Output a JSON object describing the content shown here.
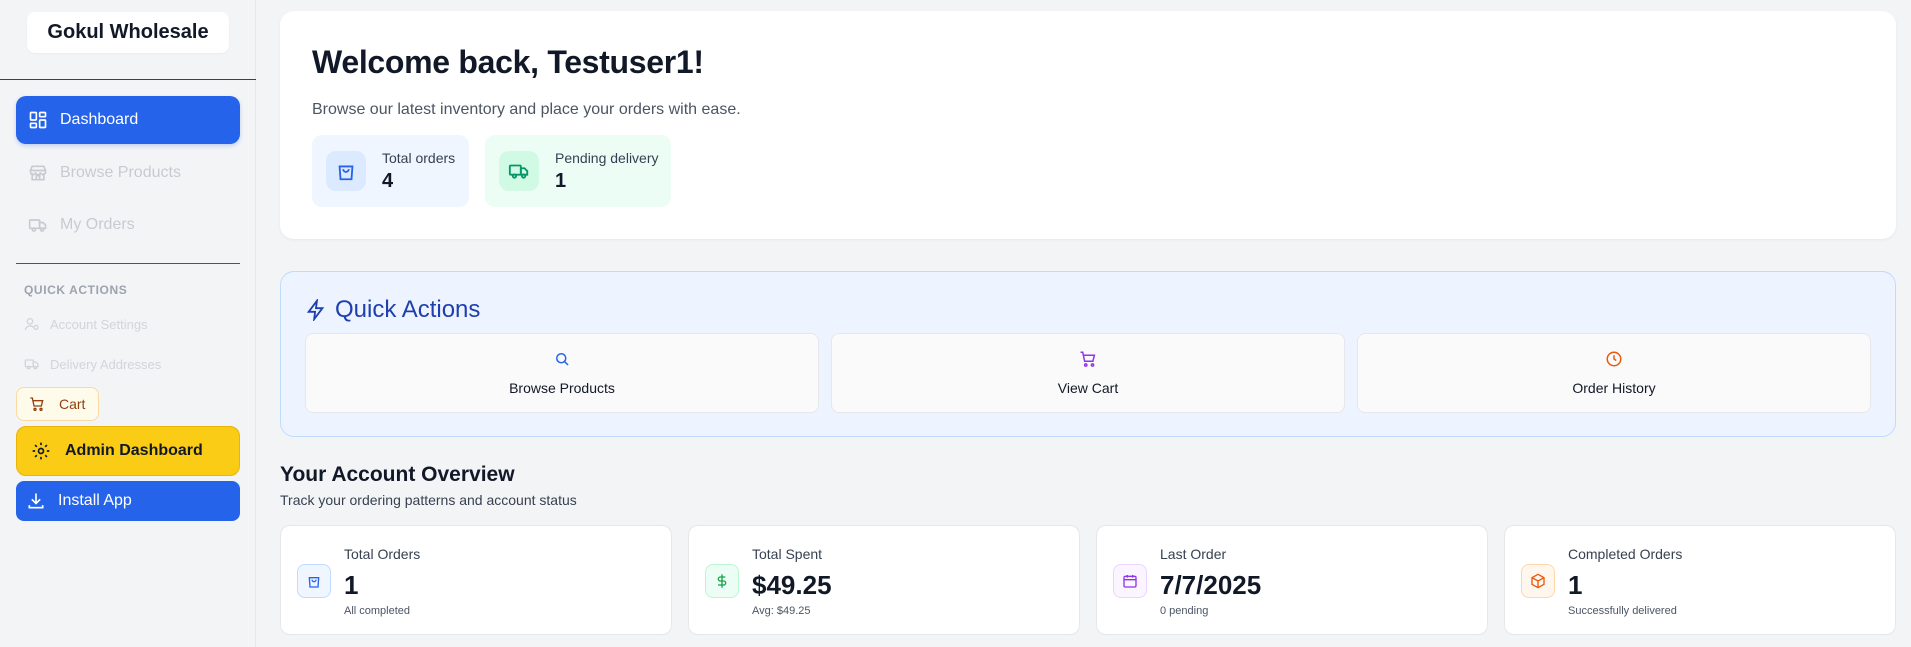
{
  "sidebar": {
    "brand": "Gokul Wholesale",
    "nav": [
      {
        "label": "Dashboard",
        "icon": "dashboard-icon",
        "active": true
      },
      {
        "label": "Browse Products",
        "icon": "store-icon",
        "active": false
      },
      {
        "label": "My Orders",
        "icon": "truck-icon",
        "active": false
      }
    ],
    "quick_actions_heading": "QUICK ACTIONS",
    "quick_links": [
      {
        "label": "Account Settings",
        "icon": "user-settings-icon"
      },
      {
        "label": "Delivery Addresses",
        "icon": "truck-icon"
      }
    ],
    "cart_label": "Cart",
    "admin_label": "Admin Dashboard",
    "install_label": "Install App"
  },
  "welcome": {
    "title": "Welcome back, Testuser1!",
    "subtitle": "Browse our latest inventory and place your orders with ease.",
    "stats": [
      {
        "label": "Total orders",
        "value": "4",
        "icon": "shopping-bag-icon",
        "color": "#2563eb"
      },
      {
        "label": "Pending delivery",
        "value": "1",
        "icon": "truck-icon",
        "color": "#059669"
      }
    ]
  },
  "quick_actions": {
    "title": "Quick Actions",
    "buttons": [
      {
        "label": "Browse Products",
        "icon": "search-icon",
        "color": "#2563eb"
      },
      {
        "label": "View Cart",
        "icon": "cart-icon",
        "color": "#9333ea"
      },
      {
        "label": "Order History",
        "icon": "clock-icon",
        "color": "#ea580c"
      }
    ]
  },
  "overview": {
    "title": "Your Account Overview",
    "subtitle": "Track your ordering patterns and account status",
    "cards": [
      {
        "label": "Total Orders",
        "value": "1",
        "note": "All completed",
        "icon": "shopping-bag-icon",
        "color": "#2563eb"
      },
      {
        "label": "Total Spent",
        "value": "$49.25",
        "note": "Avg: $49.25",
        "icon": "dollar-icon",
        "color": "#16a34a"
      },
      {
        "label": "Last Order",
        "value": "7/7/2025",
        "note": "0 pending",
        "icon": "calendar-icon",
        "color": "#9333ea"
      },
      {
        "label": "Completed Orders",
        "value": "1",
        "note": "Successfully delivered",
        "icon": "package-icon",
        "color": "#ea580c"
      }
    ]
  }
}
